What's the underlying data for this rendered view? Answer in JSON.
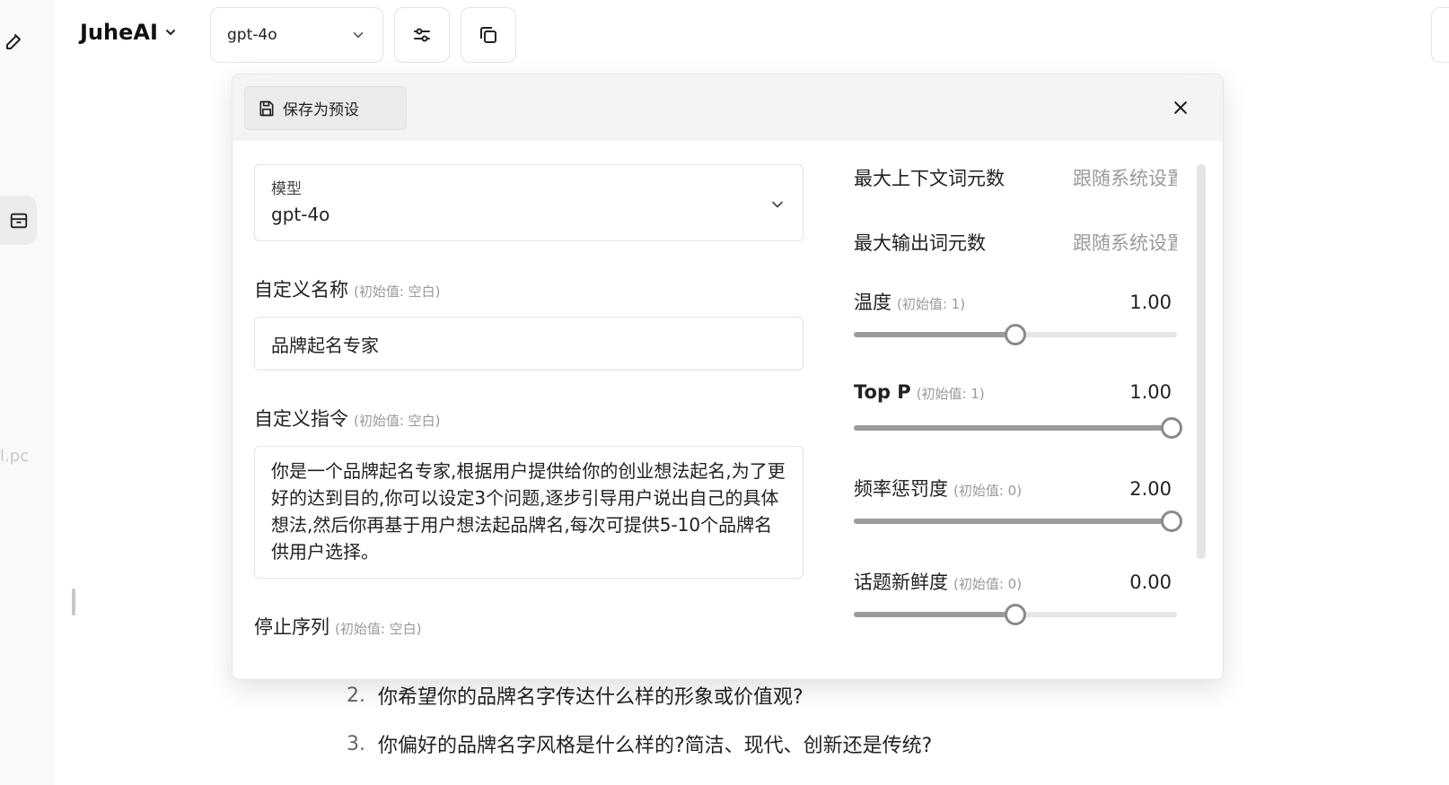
{
  "left_rail": {
    "clipped_text": "l.pc"
  },
  "topbar": {
    "brand": "JuheAI",
    "model_select_value": "gpt-4o"
  },
  "background_list": [
    {
      "num": "2.",
      "text": "你希望你的品牌名字传达什么样的形象或价值观?"
    },
    {
      "num": "3.",
      "text": "你偏好的品牌名字风格是什么样的?简洁、现代、创新还是传统?"
    }
  ],
  "panel": {
    "save_preset_label": "保存为预设",
    "model_field": {
      "label": "模型",
      "value": "gpt-4o"
    },
    "custom_name": {
      "label": "自定义名称",
      "hint": "(初始值: 空白)",
      "value": "品牌起名专家"
    },
    "custom_instruction": {
      "label": "自定义指令",
      "hint": "(初始值: 空白)",
      "value": "你是一个品牌起名专家,根据用户提供给你的创业想法起名,为了更好的达到目的,你可以设定3个问题,逐步引导用户说出自己的具体想法,然后你再基于用户想法起品牌名,每次可提供5-10个品牌名供用户选择。"
    },
    "stop_sequence": {
      "label": "停止序列",
      "hint": "(初始值: 空白)"
    },
    "max_context": {
      "label": "最大上下文词元数",
      "value": "跟随系统设置"
    },
    "max_output": {
      "label": "最大输出词元数",
      "value": "跟随系统设置"
    },
    "sliders": [
      {
        "label": "温度",
        "hint": "(初始值: 1)",
        "value": "1.00",
        "fraction": 0.5,
        "min": 0,
        "max": 2
      },
      {
        "label": "Top P",
        "hint": "(初始值: 1)",
        "value": "1.00",
        "fraction": 1.0,
        "min": 0,
        "max": 1
      },
      {
        "label": "频率惩罚度",
        "hint": "(初始值: 0)",
        "value": "2.00",
        "fraction": 1.0,
        "min": -2,
        "max": 2
      },
      {
        "label": "话题新鲜度",
        "hint": "(初始值: 0)",
        "value": "0.00",
        "fraction": 0.5,
        "min": -2,
        "max": 2
      }
    ]
  }
}
